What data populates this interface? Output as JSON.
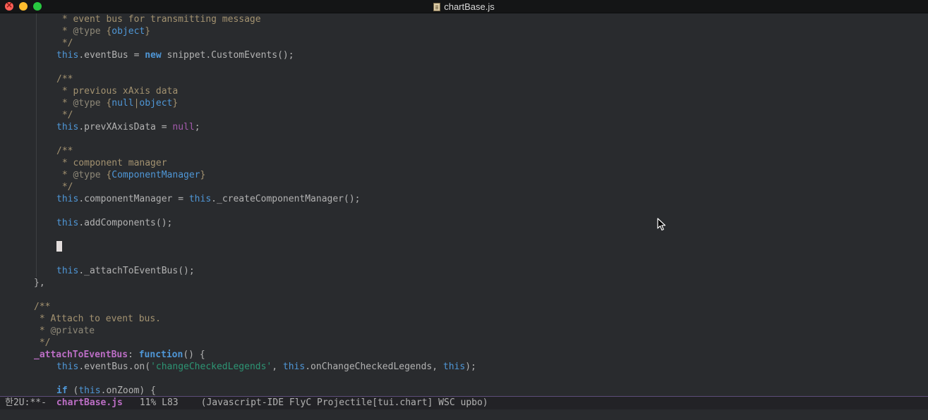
{
  "window": {
    "title": "chartBase.js",
    "icons": [
      "close-button",
      "minimize-button",
      "zoom-button",
      "document-icon"
    ]
  },
  "editor": {
    "lines": [
      {
        "indent": 1,
        "guide": true,
        "tokens": [
          {
            "c": "c-comment",
            "t": " * event bus for transmitting message"
          }
        ]
      },
      {
        "indent": 1,
        "guide": true,
        "tokens": [
          {
            "c": "c-comment",
            "t": " * "
          },
          {
            "c": "c-doctag",
            "t": "@type"
          },
          {
            "c": "c-comment",
            "t": " {"
          },
          {
            "c": "c-type",
            "t": "object"
          },
          {
            "c": "c-comment",
            "t": "}"
          }
        ]
      },
      {
        "indent": 1,
        "guide": true,
        "tokens": [
          {
            "c": "c-comment",
            "t": " */"
          }
        ]
      },
      {
        "indent": 1,
        "guide": true,
        "tokens": [
          {
            "c": "c-this",
            "t": "this"
          },
          {
            "c": "c-plain",
            "t": ".eventBus = "
          },
          {
            "c": "c-kw",
            "t": "new"
          },
          {
            "c": "c-plain",
            "t": " snippet.CustomEvents();"
          }
        ]
      },
      {
        "indent": 0,
        "guide": true,
        "tokens": []
      },
      {
        "indent": 1,
        "guide": true,
        "tokens": [
          {
            "c": "c-comment",
            "t": "/**"
          }
        ]
      },
      {
        "indent": 1,
        "guide": true,
        "tokens": [
          {
            "c": "c-comment",
            "t": " * previous xAxis data"
          }
        ]
      },
      {
        "indent": 1,
        "guide": true,
        "tokens": [
          {
            "c": "c-comment",
            "t": " * "
          },
          {
            "c": "c-doctag",
            "t": "@type"
          },
          {
            "c": "c-comment",
            "t": " {"
          },
          {
            "c": "c-type",
            "t": "null"
          },
          {
            "c": "c-comment",
            "t": "|"
          },
          {
            "c": "c-type",
            "t": "object"
          },
          {
            "c": "c-comment",
            "t": "}"
          }
        ]
      },
      {
        "indent": 1,
        "guide": true,
        "tokens": [
          {
            "c": "c-comment",
            "t": " */"
          }
        ]
      },
      {
        "indent": 1,
        "guide": true,
        "tokens": [
          {
            "c": "c-this",
            "t": "this"
          },
          {
            "c": "c-plain",
            "t": ".prevXAxisData = "
          },
          {
            "c": "c-null",
            "t": "null"
          },
          {
            "c": "c-plain",
            "t": ";"
          }
        ]
      },
      {
        "indent": 0,
        "guide": true,
        "tokens": []
      },
      {
        "indent": 1,
        "guide": true,
        "tokens": [
          {
            "c": "c-comment",
            "t": "/**"
          }
        ]
      },
      {
        "indent": 1,
        "guide": true,
        "tokens": [
          {
            "c": "c-comment",
            "t": " * component manager"
          }
        ]
      },
      {
        "indent": 1,
        "guide": true,
        "tokens": [
          {
            "c": "c-comment",
            "t": " * "
          },
          {
            "c": "c-doctag",
            "t": "@type"
          },
          {
            "c": "c-comment",
            "t": " {"
          },
          {
            "c": "c-type",
            "t": "ComponentManager"
          },
          {
            "c": "c-comment",
            "t": "}"
          }
        ]
      },
      {
        "indent": 1,
        "guide": true,
        "tokens": [
          {
            "c": "c-comment",
            "t": " */"
          }
        ]
      },
      {
        "indent": 1,
        "guide": true,
        "tokens": [
          {
            "c": "c-this",
            "t": "this"
          },
          {
            "c": "c-plain",
            "t": ".componentManager = "
          },
          {
            "c": "c-this",
            "t": "this"
          },
          {
            "c": "c-plain",
            "t": "._createComponentManager();"
          }
        ]
      },
      {
        "indent": 0,
        "guide": true,
        "tokens": []
      },
      {
        "indent": 1,
        "guide": true,
        "tokens": [
          {
            "c": "c-this",
            "t": "this"
          },
          {
            "c": "c-plain",
            "t": ".addComponents();"
          }
        ]
      },
      {
        "indent": 0,
        "guide": true,
        "tokens": []
      },
      {
        "indent": 1,
        "guide": true,
        "cursor": true,
        "tokens": []
      },
      {
        "indent": 0,
        "guide": true,
        "tokens": []
      },
      {
        "indent": 1,
        "guide": true,
        "tokens": [
          {
            "c": "c-this",
            "t": "this"
          },
          {
            "c": "c-plain",
            "t": "._attachToEventBus();"
          }
        ]
      },
      {
        "indent": 0,
        "guide": false,
        "tokens": [
          {
            "c": "c-plain",
            "t": "},"
          }
        ]
      },
      {
        "indent": 0,
        "guide": false,
        "tokens": []
      },
      {
        "indent": 0,
        "guide": false,
        "tokens": [
          {
            "c": "c-comment",
            "t": "/**"
          }
        ]
      },
      {
        "indent": 0,
        "guide": false,
        "tokens": [
          {
            "c": "c-comment",
            "t": " * Attach to event bus."
          }
        ]
      },
      {
        "indent": 0,
        "guide": false,
        "tokens": [
          {
            "c": "c-comment",
            "t": " * "
          },
          {
            "c": "c-doctag",
            "t": "@private"
          }
        ]
      },
      {
        "indent": 0,
        "guide": false,
        "tokens": [
          {
            "c": "c-comment",
            "t": " */"
          }
        ]
      },
      {
        "indent": 0,
        "guide": false,
        "tokens": [
          {
            "c": "c-fn",
            "t": "_attachToEventBus"
          },
          {
            "c": "c-plain",
            "t": ": "
          },
          {
            "c": "c-kw",
            "t": "function"
          },
          {
            "c": "c-plain",
            "t": "() {"
          }
        ]
      },
      {
        "indent": 1,
        "guide": false,
        "tokens": [
          {
            "c": "c-this",
            "t": "this"
          },
          {
            "c": "c-plain",
            "t": ".eventBus.on("
          },
          {
            "c": "c-str",
            "t": "'changeCheckedLegends'"
          },
          {
            "c": "c-plain",
            "t": ", "
          },
          {
            "c": "c-this",
            "t": "this"
          },
          {
            "c": "c-plain",
            "t": ".onChangeCheckedLegends, "
          },
          {
            "c": "c-this",
            "t": "this"
          },
          {
            "c": "c-plain",
            "t": ");"
          }
        ]
      },
      {
        "indent": 0,
        "guide": false,
        "tokens": []
      },
      {
        "indent": 1,
        "guide": false,
        "tokens": [
          {
            "c": "c-kw",
            "t": "if"
          },
          {
            "c": "c-plain",
            "t": " ("
          },
          {
            "c": "c-this",
            "t": "this"
          },
          {
            "c": "c-plain",
            "t": ".onZoom) {"
          }
        ]
      }
    ]
  },
  "modeline": {
    "state": "한2U:**-",
    "buffer": "chartBase.js",
    "position": "11% L83",
    "modes": "(Javascript-IDE FlyC Projectile[tui.chart] WSC upbo)"
  }
}
